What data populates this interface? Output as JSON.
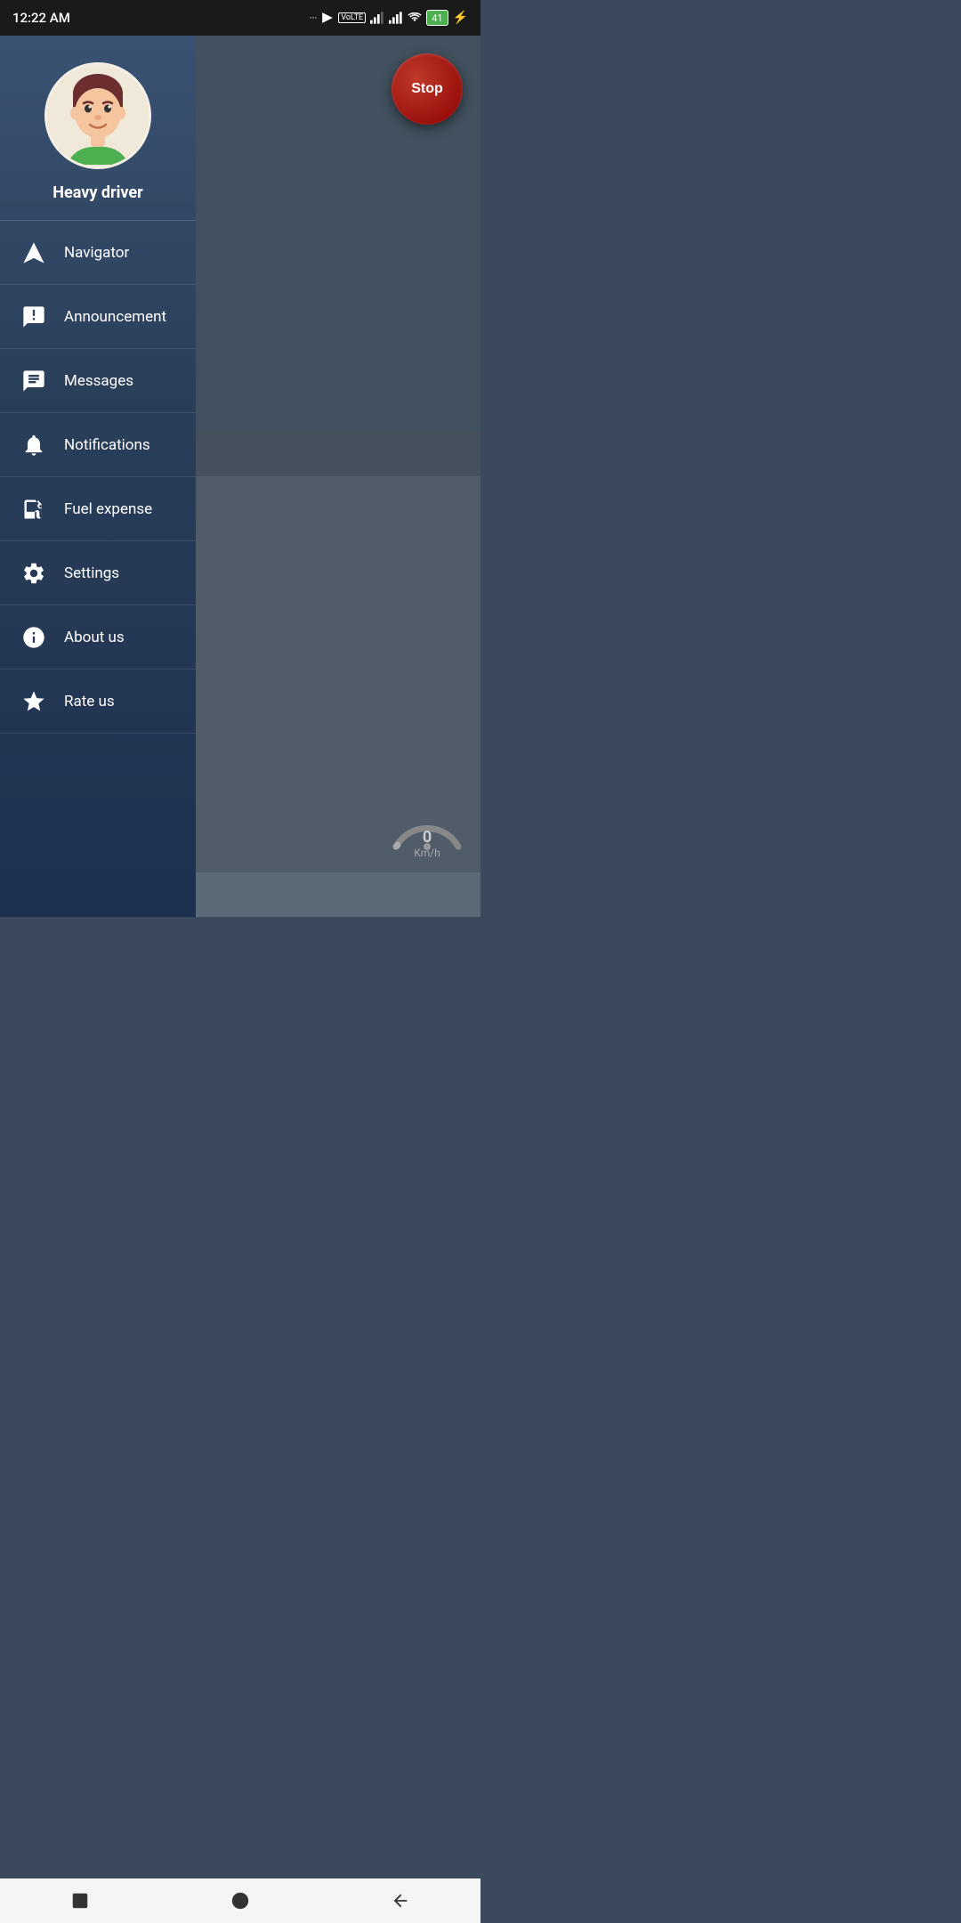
{
  "statusBar": {
    "time": "12:22 AM",
    "batteryLevel": "41"
  },
  "profile": {
    "name": "Heavy driver"
  },
  "stopButton": {
    "label": "Stop"
  },
  "speedometer": {
    "speed": "0",
    "unit": "Km/h"
  },
  "menu": {
    "items": [
      {
        "id": "navigator",
        "label": "Navigator",
        "icon": "navigator-icon"
      },
      {
        "id": "announcement",
        "label": "Announcement",
        "icon": "announcement-icon"
      },
      {
        "id": "messages",
        "label": "Messages",
        "icon": "messages-icon"
      },
      {
        "id": "notifications",
        "label": "Notifications",
        "icon": "notifications-icon"
      },
      {
        "id": "fuel-expense",
        "label": "Fuel expense",
        "icon": "fuel-icon"
      },
      {
        "id": "settings",
        "label": "Settings",
        "icon": "settings-icon"
      },
      {
        "id": "about-us",
        "label": "About us",
        "icon": "info-icon"
      },
      {
        "id": "rate-us",
        "label": "Rate us",
        "icon": "star-icon"
      }
    ]
  }
}
